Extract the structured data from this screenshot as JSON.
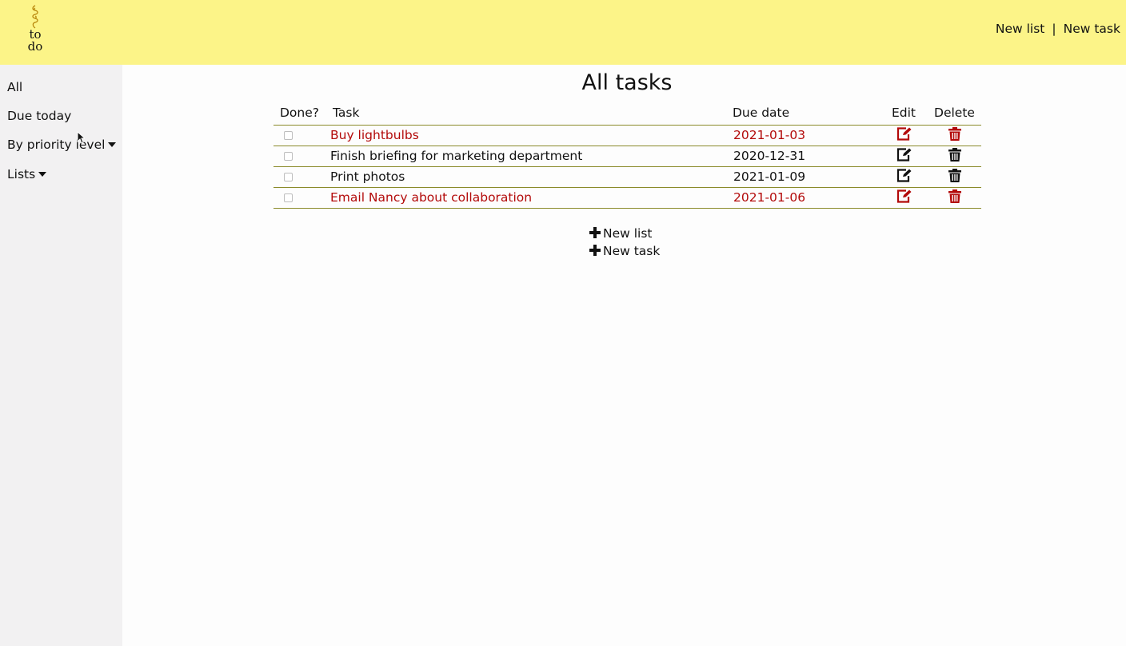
{
  "logo": {
    "line1": "to",
    "line2": "do",
    "icon": "decorative-swirl-icon"
  },
  "topnav": {
    "new_list": "New list",
    "separator": "|",
    "new_task": "New task"
  },
  "sidebar": {
    "items": [
      {
        "label": "All"
      },
      {
        "label": "Due today"
      },
      {
        "label": "By priority level"
      },
      {
        "label": "Lists"
      }
    ]
  },
  "page_title": "All tasks",
  "table": {
    "headers": {
      "done": "Done?",
      "task": "Task",
      "due": "Due date",
      "edit": "Edit",
      "delete": "Delete"
    },
    "rows": [
      {
        "done": false,
        "task": "Buy lightbulbs",
        "due": "2021-01-03",
        "highlight": true
      },
      {
        "done": false,
        "task": "Finish briefing for marketing department",
        "due": "2020-12-31",
        "highlight": false
      },
      {
        "done": false,
        "task": "Print photos",
        "due": "2021-01-09",
        "highlight": false
      },
      {
        "done": false,
        "task": "Email Nancy about collaboration",
        "due": "2021-01-06",
        "highlight": true
      }
    ]
  },
  "actions": {
    "new_list": "New list",
    "new_task": "New task"
  },
  "colors": {
    "header_bg": "#fcf488",
    "sidebar_bg": "#f2f1f2",
    "highlight": "#b30a0a",
    "rule": "#8a8a2a"
  }
}
